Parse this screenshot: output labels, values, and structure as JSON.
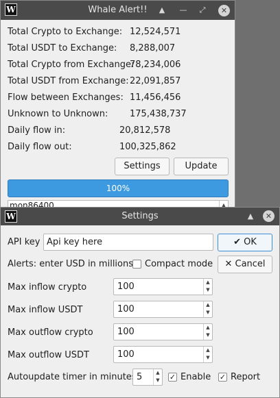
{
  "main_window": {
    "title": "Whale Alert!!",
    "app_icon": "W",
    "stats": [
      {
        "label": "Total Crypto to Exchange:",
        "value": "12,524,571"
      },
      {
        "label": "Total USDT to Exchange:",
        "value": "8,288,007"
      },
      {
        "label": "Total Crypto from Exchange:",
        "value": "78,234,006"
      },
      {
        "label": "Total USDT from Exchange:",
        "value": "22,091,857"
      },
      {
        "label": "Flow between Exchanges:",
        "value": "11,456,456"
      },
      {
        "label": "Unknown to Unknown:",
        "value": "175,438,737"
      },
      {
        "label": "Daily flow in:",
        "value": "20,812,578"
      },
      {
        "label": "Daily flow out:",
        "value": "100,325,862"
      }
    ],
    "settings_label": "Settings",
    "update_label": "Update",
    "progress_text": "100%",
    "progress_value": 1.0,
    "log_text": "mon86400"
  },
  "settings_dialog": {
    "title": "Settings",
    "app_icon": "W",
    "api_key_label": "API key",
    "api_key_value": "Api key here",
    "ok_label": "OK",
    "alerts_note": "Alerts: enter USD in millions.",
    "compact_mode_label": "Compact mode",
    "compact_mode_checked": false,
    "cancel_label": "Cancel",
    "fields": [
      {
        "label": "Max inflow crypto",
        "value": "100"
      },
      {
        "label": "Max inflow USDT",
        "value": "100"
      },
      {
        "label": "Max outflow crypto",
        "value": "100"
      },
      {
        "label": "Max outflow USDT",
        "value": "100"
      }
    ],
    "autoupdate_label": "Autoupdate timer in minutes",
    "autoupdate_value": "5",
    "enable_label": "Enable",
    "enable_checked": true,
    "report_label": "Report",
    "report_checked": true
  },
  "colors": {
    "titlebar": "#4a4a4a",
    "progress_fill": "#3d9ae0",
    "primary_border": "#3d8ed8"
  }
}
